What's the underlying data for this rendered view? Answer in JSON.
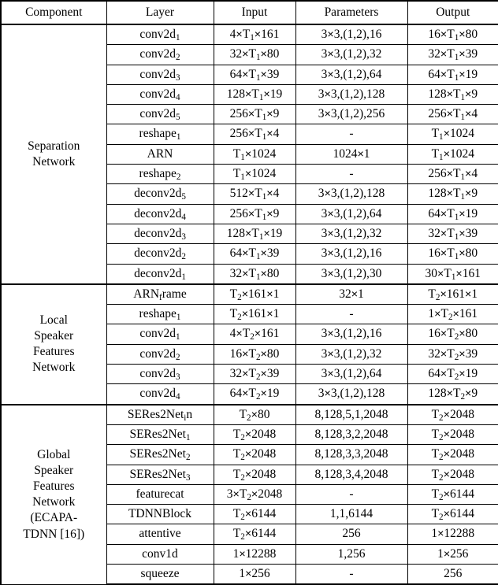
{
  "table": {
    "columns": [
      "Component",
      "Layer",
      "Input",
      "Parameters",
      "Output"
    ],
    "sections": [
      {
        "component": "Separation\nNetwork",
        "component_lines": [
          "Separation",
          "Network"
        ],
        "rows": [
          {
            "layer": "conv2d_1",
            "input": "4×T_1×161",
            "parameters": "3×3,(1,2),16",
            "output": "16×T_1×80"
          },
          {
            "layer": "conv2d_2",
            "input": "32×T_1×80",
            "parameters": "3×3,(1,2),32",
            "output": "32×T_1×39"
          },
          {
            "layer": "conv2d_3",
            "input": "64×T_1×39",
            "parameters": "3×3,(1,2),64",
            "output": "64×T_1×19"
          },
          {
            "layer": "conv2d_4",
            "input": "128×T_1×19",
            "parameters": "3×3,(1,2),128",
            "output": "128×T_1×9"
          },
          {
            "layer": "conv2d_5",
            "input": "256×T_1×9",
            "parameters": "3×3,(1,2),256",
            "output": "256×T_1×4"
          },
          {
            "layer": "reshape_1",
            "input": "256×T_1×4",
            "parameters": "-",
            "output": "T_1×1024"
          },
          {
            "layer": "ARN",
            "input": "T_1×1024",
            "parameters": "1024×1",
            "output": "T_1×1024"
          },
          {
            "layer": "reshape_2",
            "input": "T_1×1024",
            "parameters": "-",
            "output": "256×T_1×4"
          },
          {
            "layer": "deconv2d_5",
            "input": "512×T_1×4",
            "parameters": "3×3,(1,2),128",
            "output": "128×T_1×9"
          },
          {
            "layer": "deconv2d_4",
            "input": "256×T_1×9",
            "parameters": "3×3,(1,2),64",
            "output": "64×T_1×19"
          },
          {
            "layer": "deconv2d_3",
            "input": "128×T_1×19",
            "parameters": "3×3,(1,2),32",
            "output": "32×T_1×39"
          },
          {
            "layer": "deconv2d_2",
            "input": "64×T_1×39",
            "parameters": "3×3,(1,2),16",
            "output": "16×T_1×80"
          },
          {
            "layer": "deconv2d_1",
            "input": "32×T_1×80",
            "parameters": "3×3,(1,2),30",
            "output": "30×T_1×161"
          }
        ]
      },
      {
        "component": "Local Speaker Features Network",
        "component_lines": [
          "Local",
          "Speaker",
          "Features",
          "Network"
        ],
        "rows": [
          {
            "layer": "ARN_frame",
            "input": "T_2×161×1",
            "parameters": "32×1",
            "output": "T_2×161×1"
          },
          {
            "layer": "reshape_1",
            "input": "T_2×161×1",
            "parameters": "-",
            "output": "1×T_2×161"
          },
          {
            "layer": "conv2d_1",
            "input": "4×T_2×161",
            "parameters": "3×3,(1,2),16",
            "output": "16×T_2×80"
          },
          {
            "layer": "conv2d_2",
            "input": "16×T_2×80",
            "parameters": "3×3,(1,2),32",
            "output": "32×T_2×39"
          },
          {
            "layer": "conv2d_3",
            "input": "32×T_2×39",
            "parameters": "3×3,(1,2),64",
            "output": "64×T_2×19"
          },
          {
            "layer": "conv2d_4",
            "input": "64×T_2×19",
            "parameters": "3×3,(1,2),128",
            "output": "128×T_2×9"
          }
        ]
      },
      {
        "component": "Global Speaker Features Network (ECAPA-TDNN [16])",
        "component_lines": [
          "Global",
          "Speaker",
          "Features",
          "Network",
          "(ECAPA-",
          "TDNN [16])"
        ],
        "rows": [
          {
            "layer": "SERes2Net_in",
            "input": "T_2×80",
            "parameters": "8,128,5,1,2048",
            "output": "T_2×2048"
          },
          {
            "layer": "SERes2Net_1",
            "input": "T_2×2048",
            "parameters": "8,128,3,2,2048",
            "output": "T_2×2048"
          },
          {
            "layer": "SERes2Net_2",
            "input": "T_2×2048",
            "parameters": "8,128,3,3,2048",
            "output": "T_2×2048"
          },
          {
            "layer": "SERes2Net_3",
            "input": "T_2×2048",
            "parameters": "8,128,3,4,2048",
            "output": "T_2×2048"
          },
          {
            "layer": "featurecat",
            "input": "3×T_2×2048",
            "parameters": "-",
            "output": "T_2×6144"
          },
          {
            "layer": "TDNNBlock",
            "input": "T_2×6144",
            "parameters": "1,1,6144",
            "output": "T_2×6144"
          },
          {
            "layer": "attentive",
            "input": "T_2×6144",
            "parameters": "256",
            "output": "1×12288"
          },
          {
            "layer": "conv1d",
            "input": "1×12288",
            "parameters": "1,256",
            "output": "1×256"
          },
          {
            "layer": "squeeze",
            "input": "1×256",
            "parameters": "-",
            "output": "256"
          }
        ]
      }
    ]
  }
}
